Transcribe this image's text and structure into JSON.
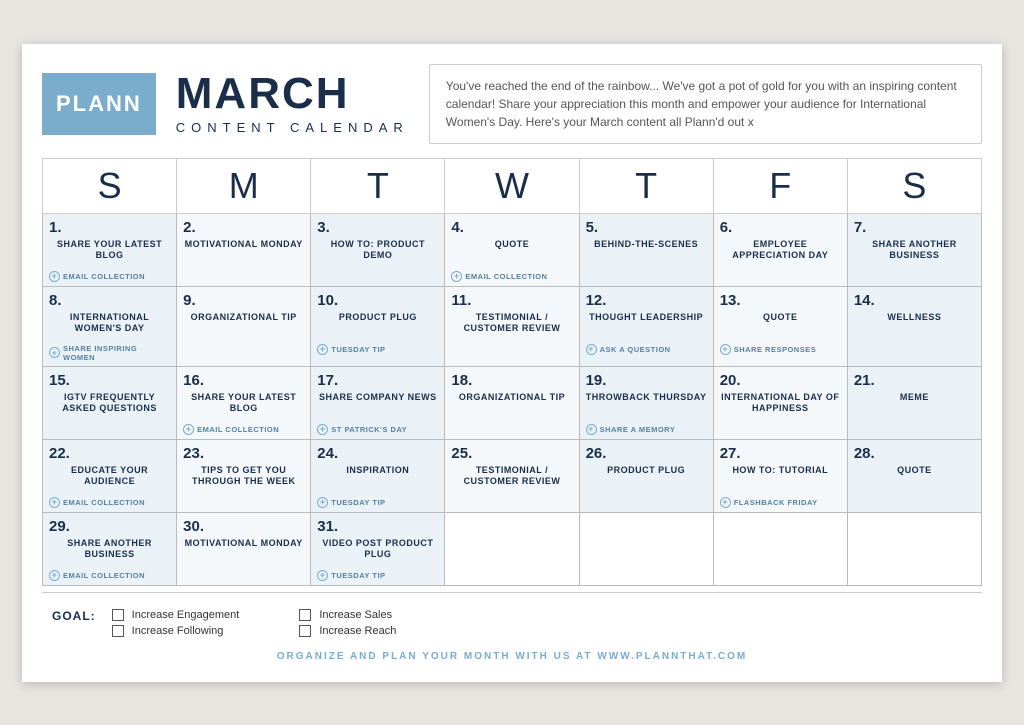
{
  "header": {
    "logo": "PLANN",
    "month": "MARCH",
    "subtitle": "CONTENT CALENDAR",
    "description": "You've reached the end of the rainbow... We've got a pot of gold for you with an inspiring content calendar! Share your appreciation this month and empower your audience for International Women's Day. Here's your March content all Plann'd out x"
  },
  "days_header": [
    "S",
    "M",
    "T",
    "W",
    "T",
    "F",
    "S"
  ],
  "weeks": [
    [
      {
        "num": "1.",
        "content": "SHARE YOUR\nLATEST BLOG",
        "tag": "EMAIL COLLECTION",
        "shade": "light"
      },
      {
        "num": "2.",
        "content": "MOTIVATIONAL MONDAY",
        "tag": "",
        "shade": "white"
      },
      {
        "num": "3.",
        "content": "HOW TO:\nPRODUCT DEMO",
        "tag": "",
        "shade": "light"
      },
      {
        "num": "4.",
        "content": "QUOTE",
        "tag": "EMAIL COLLECTION",
        "shade": "white"
      },
      {
        "num": "5.",
        "content": "BEHIND-THE-SCENES",
        "tag": "",
        "shade": "light"
      },
      {
        "num": "6.",
        "content": "EMPLOYEE\nAPPRECIATION DAY",
        "tag": "",
        "shade": "white"
      },
      {
        "num": "7.",
        "content": "SHARE ANOTHER\nBUSINESS",
        "tag": "",
        "shade": "light"
      }
    ],
    [
      {
        "num": "8.",
        "content": "INTERNATIONAL\nWOMEN'S DAY",
        "tag": "SHARE INSPIRING WOMEN",
        "shade": "light"
      },
      {
        "num": "9.",
        "content": "ORGANIZATIONAL TIP",
        "tag": "",
        "shade": "white"
      },
      {
        "num": "10.",
        "content": "PRODUCT PLUG",
        "tag": "TUESDAY TIP",
        "shade": "light"
      },
      {
        "num": "11.",
        "content": "TESTIMONIAL /\nCUSTOMER REVIEW",
        "tag": "",
        "shade": "white"
      },
      {
        "num": "12.",
        "content": "THOUGHT LEADERSHIP",
        "tag": "ASK A QUESTION",
        "shade": "light"
      },
      {
        "num": "13.",
        "content": "QUOTE",
        "tag": "SHARE RESPONSES",
        "shade": "white"
      },
      {
        "num": "14.",
        "content": "WELLNESS",
        "tag": "",
        "shade": "light"
      }
    ],
    [
      {
        "num": "15.",
        "content": "IGTV FREQUENTLY\nASKED QUESTIONS",
        "tag": "",
        "shade": "light"
      },
      {
        "num": "16.",
        "content": "SHARE YOUR\nLATEST BLOG",
        "tag": "EMAIL COLLECTION",
        "shade": "white"
      },
      {
        "num": "17.",
        "content": "SHARE COMPANY\nNEWS",
        "tag": "ST PATRICK'S DAY",
        "shade": "light"
      },
      {
        "num": "18.",
        "content": "ORGANIZATIONAL TIP",
        "tag": "",
        "shade": "white"
      },
      {
        "num": "19.",
        "content": "THROWBACK\nTHURSDAY",
        "tag": "SHARE A MEMORY",
        "shade": "light"
      },
      {
        "num": "20.",
        "content": "INTERNATIONAL DAY\nOF HAPPINESS",
        "tag": "",
        "shade": "white"
      },
      {
        "num": "21.",
        "content": "MEME",
        "tag": "",
        "shade": "light"
      }
    ],
    [
      {
        "num": "22.",
        "content": "EDUCATE YOUR\nAUDIENCE",
        "tag": "EMAIL COLLECTION",
        "shade": "light"
      },
      {
        "num": "23.",
        "content": "TIPS TO GET YOU\nTHROUGH THE WEEK",
        "tag": "",
        "shade": "white"
      },
      {
        "num": "24.",
        "content": "INSPIRATION",
        "tag": "TUESDAY TIP",
        "shade": "light"
      },
      {
        "num": "25.",
        "content": "TESTIMONIAL /\nCUSTOMER REVIEW",
        "tag": "",
        "shade": "white"
      },
      {
        "num": "26.",
        "content": "PRODUCT PLUG",
        "tag": "",
        "shade": "light"
      },
      {
        "num": "27.",
        "content": "HOW TO:\nTUTORIAL",
        "tag": "FLASHBACK FRIDAY",
        "shade": "white"
      },
      {
        "num": "28.",
        "content": "QUOTE",
        "tag": "",
        "shade": "light"
      }
    ],
    [
      {
        "num": "29.",
        "content": "SHARE ANOTHER\nBUSINESS",
        "tag": "EMAIL COLLECTION",
        "shade": "light"
      },
      {
        "num": "30.",
        "content": "MOTIVATIONAL MONDAY",
        "tag": "",
        "shade": "white"
      },
      {
        "num": "31.",
        "content": "VIDEO POST\nPRODUCT PLUG",
        "tag": "TUESDAY TIP",
        "shade": "light"
      },
      {
        "num": "",
        "content": "",
        "tag": "",
        "shade": "empty"
      },
      {
        "num": "",
        "content": "",
        "tag": "",
        "shade": "empty"
      },
      {
        "num": "",
        "content": "",
        "tag": "",
        "shade": "empty"
      },
      {
        "num": "",
        "content": "",
        "tag": "",
        "shade": "empty"
      }
    ]
  ],
  "goals": {
    "label": "GOAL:",
    "items": [
      {
        "text": "Increase Engagement"
      },
      {
        "text": "Increase Sales"
      },
      {
        "text": "Increase Following"
      },
      {
        "text": "Increase Reach"
      }
    ]
  },
  "footer_text": "ORGANIZE AND PLAN YOUR MONTH WITH US AT WWW.PLANNTHAT.COM"
}
